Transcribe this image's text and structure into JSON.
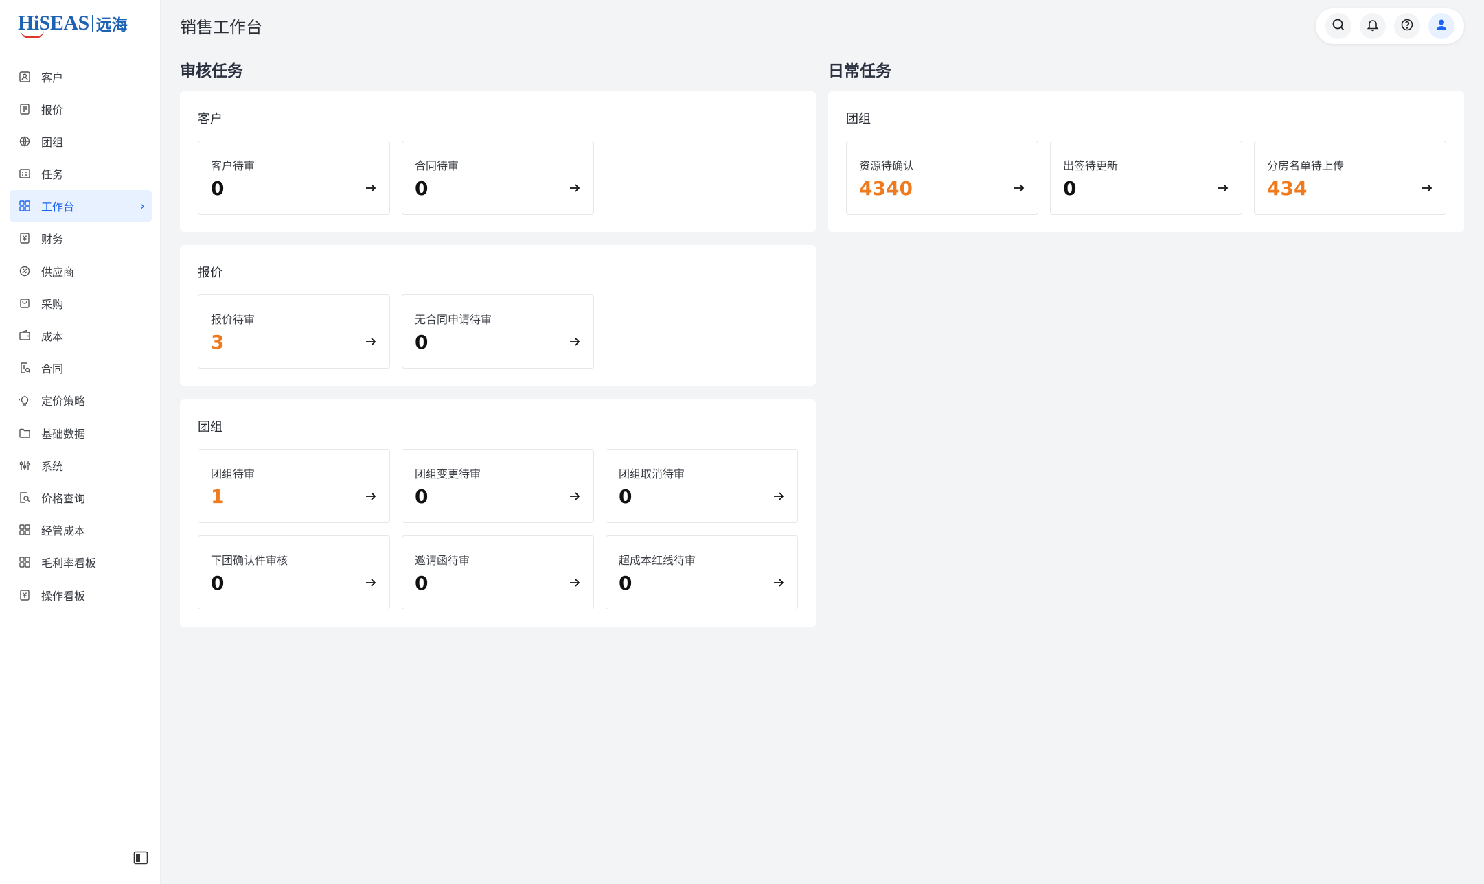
{
  "brand": {
    "logo_en": "HiSEAS",
    "logo_cn": "远海"
  },
  "sidebar": {
    "items": [
      {
        "label": "客户",
        "icon": "customer-icon"
      },
      {
        "label": "报价",
        "icon": "quote-icon"
      },
      {
        "label": "团组",
        "icon": "group-icon"
      },
      {
        "label": "任务",
        "icon": "task-icon"
      },
      {
        "label": "工作台",
        "icon": "workbench-icon",
        "active": true
      },
      {
        "label": "财务",
        "icon": "finance-icon"
      },
      {
        "label": "供应商",
        "icon": "supplier-icon"
      },
      {
        "label": "采购",
        "icon": "purchase-icon"
      },
      {
        "label": "成本",
        "icon": "cost-icon"
      },
      {
        "label": "合同",
        "icon": "contract-icon"
      },
      {
        "label": "定价策略",
        "icon": "pricing-icon"
      },
      {
        "label": "基础数据",
        "icon": "folder-icon"
      },
      {
        "label": "系统",
        "icon": "settings-sliders-icon"
      },
      {
        "label": "价格查询",
        "icon": "price-search-icon"
      },
      {
        "label": "经管成本",
        "icon": "grid-icon"
      },
      {
        "label": "毛利率看板",
        "icon": "grid-icon"
      },
      {
        "label": "操作看板",
        "icon": "yen-board-icon"
      }
    ]
  },
  "header": {
    "title": "销售工作台"
  },
  "colors": {
    "accent": "#1c64f2",
    "highlight": "#f07a1e",
    "active_bg": "#e8f1ff"
  },
  "review": {
    "title": "审核任务",
    "customer": {
      "label": "客户",
      "cards": [
        {
          "label": "客户待审",
          "value": "0"
        },
        {
          "label": "合同待审",
          "value": "0"
        }
      ]
    },
    "quote": {
      "label": "报价",
      "cards": [
        {
          "label": "报价待审",
          "value": "3"
        },
        {
          "label": "无合同申请待审",
          "value": "0"
        }
      ]
    },
    "group": {
      "label": "团组",
      "cards": [
        {
          "label": "团组待审",
          "value": "1"
        },
        {
          "label": "团组变更待审",
          "value": "0"
        },
        {
          "label": "团组取消待审",
          "value": "0"
        },
        {
          "label": "下团确认件审核",
          "value": "0"
        },
        {
          "label": "邀请函待审",
          "value": "0"
        },
        {
          "label": "超成本红线待审",
          "value": "0"
        }
      ]
    }
  },
  "daily": {
    "title": "日常任务",
    "group": {
      "label": "团组",
      "cards": [
        {
          "label": "资源待确认",
          "value": "4340"
        },
        {
          "label": "出签待更新",
          "value": "0"
        },
        {
          "label": "分房名单待上传",
          "value": "434"
        }
      ]
    }
  }
}
